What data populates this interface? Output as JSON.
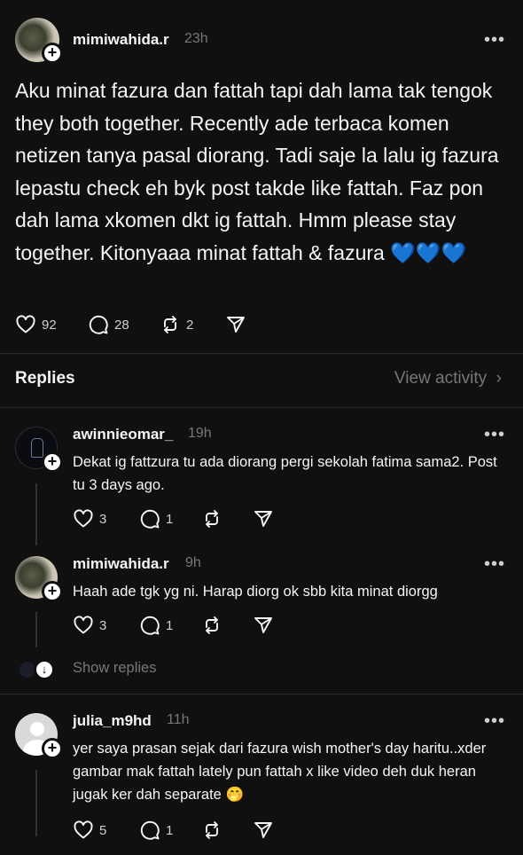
{
  "post": {
    "username": "mimiwahida.r",
    "time": "23h",
    "more": "•••",
    "text": "Aku minat fazura dan fattah tapi dah lama tak tengok they both together. Recently ade terbaca komen netizen tanya pasal diorang. Tadi saje la lalu ig fazura lepastu check eh byk post takde like fattah. Faz pon dah lama xkomen dkt ig fattah. Hmm please stay together. Kitonyaaa minat fattah & fazura",
    "emoji": "💙💙💙",
    "likes": "92",
    "comments": "28",
    "reposts": "2"
  },
  "replies_header": {
    "title": "Replies",
    "view_activity": "View activity"
  },
  "replies": [
    {
      "username": "awinnieomar_",
      "time": "19h",
      "text": "Dekat ig fattzura tu ada diorang pergi sekolah fatima sama2. Post tu 3 days ago.",
      "likes": "3",
      "comments": "1"
    },
    {
      "username": "mimiwahida.r",
      "time": "9h",
      "text": "Haah ade tgk yg ni. Harap diorg ok sbb kita minat diorgg",
      "likes": "3",
      "comments": "1"
    },
    {
      "username": "julia_m9hd",
      "time": "11h",
      "text": "yer saya prasan sejak dari fazura wish mother's day haritu..xder gambar mak fattah lately pun fattah x like video deh duk heran jugak ker dah separate",
      "emoji": "🤭",
      "likes": "5",
      "comments": "1"
    }
  ],
  "show_replies": "Show replies",
  "icons": {
    "heart": "heart-icon",
    "comment": "comment-icon",
    "repost": "repost-icon",
    "share": "share-icon",
    "follow": "plus-icon"
  },
  "colors": {
    "background": "#101010",
    "text": "#f3f5f7",
    "muted": "#777777"
  }
}
